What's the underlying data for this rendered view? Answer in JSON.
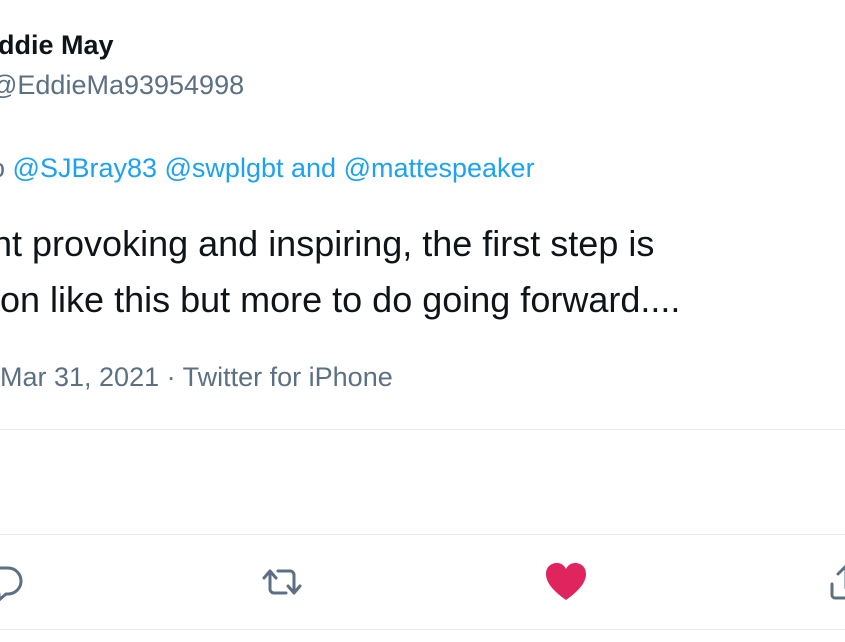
{
  "tweet": {
    "display_name": "ddie May",
    "handle": "@EddieMa93954998",
    "replying_to": {
      "prefix": "o ",
      "mentions": [
        "@SJBray83",
        "@swplgbt",
        "@mattespeaker"
      ],
      "separator_and": "and"
    },
    "text_lines": [
      "nt provoking and inspiring, the first step is",
      "ion like this but more to do going forward...."
    ],
    "timestamp": "Mar 31, 2021",
    "meta_separator": "·",
    "source": "Twitter for iPhone"
  },
  "actions": {
    "reply": {
      "icon": "reply-icon"
    },
    "retweet": {
      "icon": "retweet-icon"
    },
    "like": {
      "icon": "heart-icon",
      "liked": true,
      "color": "#e0245e"
    },
    "share": {
      "icon": "share-icon"
    }
  },
  "colors": {
    "text": "#0f1419",
    "secondary": "#5b7083",
    "accent": "#1da1f2",
    "like": "#e0245e",
    "divider": "#e6ecf0"
  }
}
